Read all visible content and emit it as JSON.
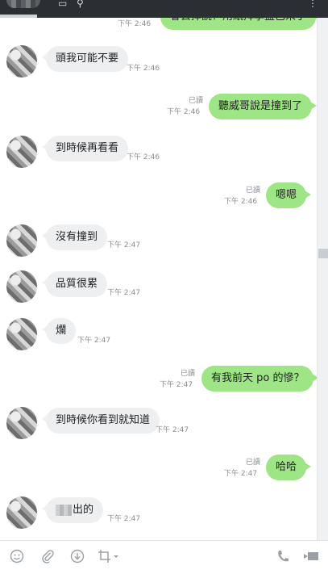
{
  "top_partial": {
    "time": "下午 2:46",
    "text": "會去摔說？用紙拜學盡已來了"
  },
  "messages": [
    {
      "dir": "in",
      "text": "頭我可能不要",
      "time": "下午 2:46"
    },
    {
      "dir": "out",
      "text": "聽威哥說是撞到了",
      "read": "已讀",
      "time": "下午 2:46"
    },
    {
      "dir": "in",
      "text": "到時候再看看",
      "time": "下午 2:46"
    },
    {
      "dir": "out",
      "text": "嗯嗯",
      "read": "已讀",
      "time": "下午 2:46"
    },
    {
      "dir": "in",
      "text": "沒有撞到",
      "time": "下午 2:47"
    },
    {
      "dir": "in",
      "text": "品質很累",
      "time": "下午 2:47"
    },
    {
      "dir": "in",
      "text": "爛",
      "time": "下午 2:47"
    },
    {
      "dir": "out",
      "text": "有我前天 po 的慘？",
      "read": "已讀",
      "time": "下午 2:47"
    },
    {
      "dir": "in",
      "text": "到時候你看到就知道",
      "time": "下午 2:47"
    },
    {
      "dir": "out",
      "text": "哈哈",
      "read": "已讀",
      "time": "下午 2:47"
    },
    {
      "dir": "in",
      "text": "出的",
      "time": "下午 2:47",
      "pixelated_prefix": true
    }
  ],
  "toolbar": {
    "icons": [
      "emoji-icon",
      "attachment-icon",
      "download-icon",
      "crop-icon",
      "phone-icon",
      "video-icon"
    ]
  },
  "colors": {
    "outgoing": "#9de585",
    "incoming": "#eeeff1",
    "titlebar": "#2b2e33"
  }
}
